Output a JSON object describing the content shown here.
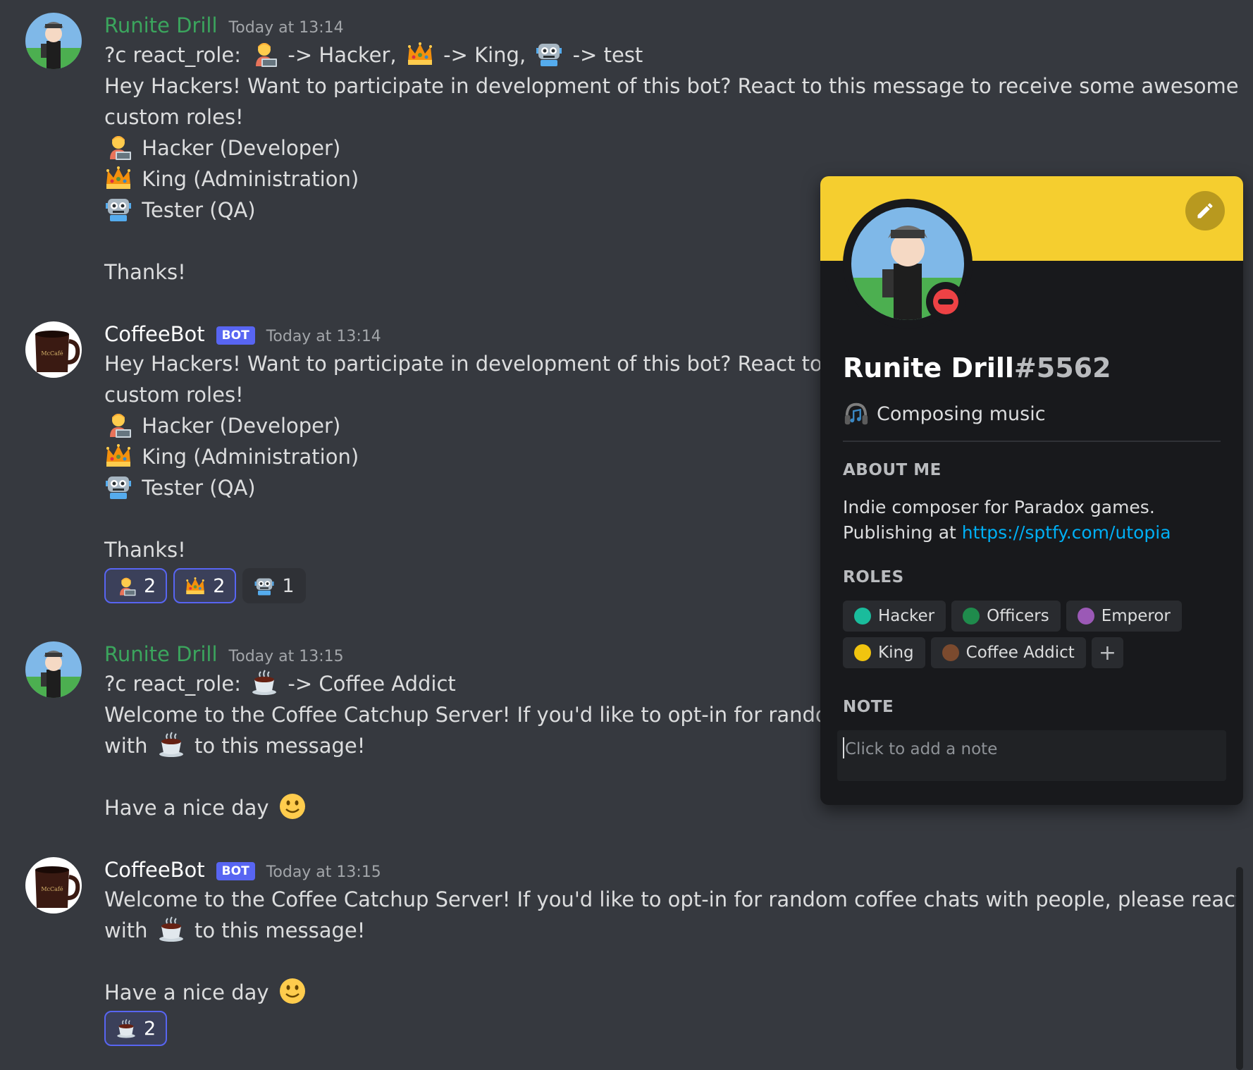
{
  "messages": [
    {
      "author": "Runite Drill",
      "time": "Today at 13:14",
      "cmd_prefix": "?c react_role:",
      "cmd_part1": "-> Hacker,",
      "cmd_part2": "-> King,",
      "cmd_part3": "-> test",
      "intro1": "Hey Hackers! Want to participate in development of this bot? React to this message to receive some awesome",
      "intro2": "custom roles!",
      "role1": "Hacker (Developer)",
      "role2": "King (Administration)",
      "role3": "Tester (QA)",
      "thanks": "Thanks!"
    },
    {
      "author": "CoffeeBot",
      "bot_tag": "BOT",
      "time": "Today at 13:14",
      "intro1": "Hey Hackers! Want to participate in development of this bot? React to this m",
      "intro2": "custom roles!",
      "role1": "Hacker (Developer)",
      "role2": "King (Administration)",
      "role3": "Tester (QA)",
      "thanks": "Thanks!",
      "reactions": [
        {
          "emoji": "technologist-icon",
          "count": "2",
          "me": true
        },
        {
          "emoji": "crown-icon",
          "count": "2",
          "me": true
        },
        {
          "emoji": "robot-icon",
          "count": "1",
          "me": false
        }
      ]
    },
    {
      "author": "Runite Drill",
      "time": "Today at 13:15",
      "cmd_prefix": "?c react_role:",
      "cmd_suffix": "-> Coffee Addict",
      "welcome1": "Welcome to the Coffee Catchup Server! If you'd like to opt-in for random coff",
      "welcome2_pre": "with",
      "welcome2_post": "to this message!",
      "bye": "Have a nice day"
    },
    {
      "author": "CoffeeBot",
      "bot_tag": "BOT",
      "time": "Today at 13:15",
      "welcome1": "Welcome to the Coffee Catchup Server! If you'd like to opt-in for random coffee chats with people, please react",
      "welcome2_pre": "with",
      "welcome2_post": "to this message!",
      "bye": "Have a nice day",
      "reactions": [
        {
          "emoji": "hot-beverage-icon",
          "count": "2",
          "me": true
        }
      ]
    }
  ],
  "profile": {
    "name": "Runite Drill",
    "discriminator": "#5562",
    "status": "do-not-disturb",
    "activity": "Composing music",
    "about_title": "ABOUT ME",
    "about_line1": "Indie composer for Paradox games.",
    "about_line2_pre": "Publishing at",
    "about_link": "https://sptfy.com/utopia",
    "roles_title": "ROLES",
    "roles": [
      {
        "name": "Hacker",
        "color": "#1abc9c"
      },
      {
        "name": "Officers",
        "color": "#1f8b4c"
      },
      {
        "name": "Emperor",
        "color": "#9b59b6"
      },
      {
        "name": "King",
        "color": "#f1c40f"
      },
      {
        "name": "Coffee Addict",
        "color": "#7b4a2e"
      }
    ],
    "add_role": "+",
    "note_title": "NOTE",
    "note_placeholder": "Click to add a note",
    "banner_color": "#f5ce2f"
  }
}
